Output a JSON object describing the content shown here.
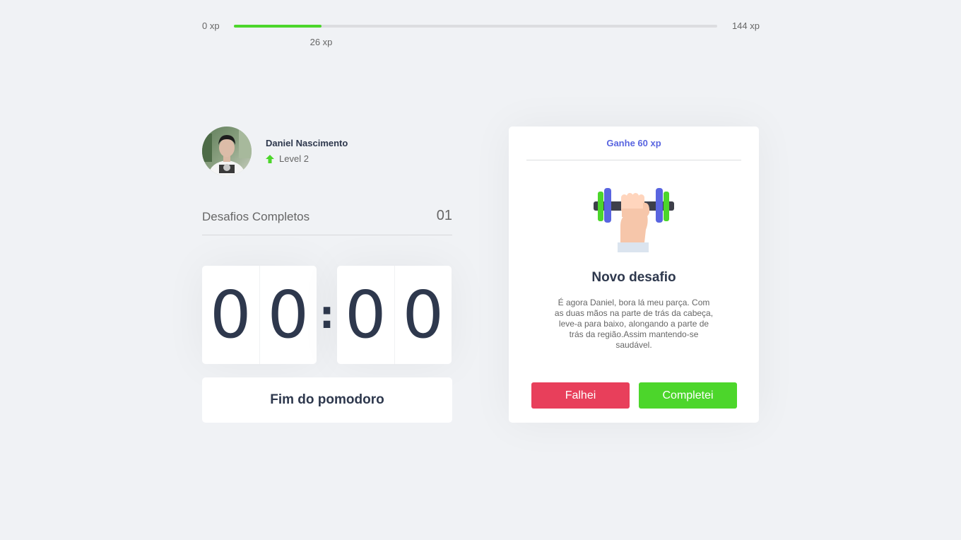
{
  "xp": {
    "min_label": "0 xp",
    "max_label": "144 xp",
    "current_label": "26 xp",
    "current": 26,
    "max": 144,
    "fill_color": "#4cd62b"
  },
  "profile": {
    "name": "Daniel Nascimento",
    "level_label": "Level 2",
    "level_icon": "arrow-up-icon"
  },
  "challenges": {
    "label": "Desafios Completos",
    "count": "01"
  },
  "countdown": {
    "minutes": [
      "0",
      "0"
    ],
    "separator": ":",
    "seconds": [
      "0",
      "0"
    ],
    "button_label": "Fim do pomodoro"
  },
  "challenge_card": {
    "header": "Ganhe 60 xp",
    "icon": "dumbbell-icon",
    "title": "Novo desafio",
    "description": "É agora Daniel, bora lá meu parça. Com as duas mãos na parte de trás da cabeça, leve-a para baixo, alongando a parte de trás da região.Assim mantendo-se saudável.",
    "fail_label": "Falhei",
    "success_label": "Completei",
    "colors": {
      "fail": "#e83f5b",
      "success": "#4cd62b",
      "accent": "#5965e0"
    }
  }
}
